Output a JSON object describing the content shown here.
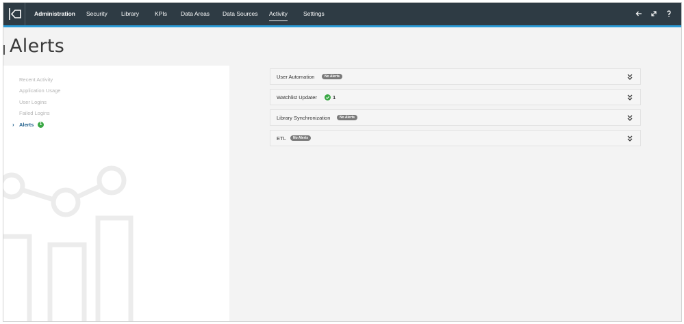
{
  "nav": {
    "items": [
      {
        "label": "Administration",
        "bold": true
      },
      {
        "label": "Security"
      },
      {
        "label": "Library"
      },
      {
        "label": "KPIs"
      },
      {
        "label": "Data Areas"
      },
      {
        "label": "Data Sources"
      },
      {
        "label": "Activity",
        "active": true
      },
      {
        "label": "Settings"
      }
    ],
    "right_icons": [
      "back-arrow-icon",
      "expand-icon",
      "help-icon"
    ]
  },
  "page": {
    "title": "Alerts"
  },
  "sidebar": {
    "items": [
      {
        "label": "Recent Activity"
      },
      {
        "label": "Application Usage"
      },
      {
        "label": "User Logins"
      },
      {
        "label": "Failed Logins"
      },
      {
        "label": "Alerts",
        "active": true,
        "badge": "1"
      }
    ]
  },
  "alerts": [
    {
      "title": "User Automation",
      "status": "No Alerts"
    },
    {
      "title": "Watchlist Updater",
      "count": "1"
    },
    {
      "title": "Library Synchronization",
      "status": "No Alerts"
    },
    {
      "title": "ETL",
      "status": "No Alerts"
    }
  ],
  "colors": {
    "topbar": "#2e3b44",
    "accent": "#2a9ad6",
    "active_link": "#1f5f8b",
    "success": "#3aa845"
  }
}
